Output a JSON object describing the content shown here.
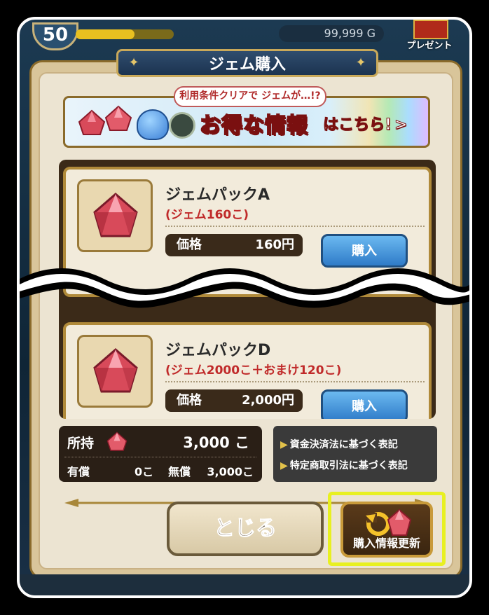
{
  "hud": {
    "level": "50",
    "gold": "99,999 G",
    "present_label": "プレゼント"
  },
  "dialog": {
    "title": "ジェム購入",
    "banner": {
      "tag": "利用条件クリアで ジェムが…!?",
      "main": "お得な情報",
      "sub": "はこちら!",
      "arrow": ">"
    },
    "products": [
      {
        "name": "ジェムパックA",
        "detail": "(ジェム160こ)",
        "price_label": "価格",
        "price": "160円",
        "buy_label": "購入"
      },
      {
        "name": "ジェムパックD",
        "detail": "(ジェム2000こ＋おまけ120こ)",
        "price_label": "価格",
        "price": "2,000円",
        "buy_label": "購入"
      }
    ],
    "holdings": {
      "label": "所持",
      "total": "3,000 こ",
      "paid_label": "有償",
      "paid_value": "0こ",
      "free_label": "無償",
      "free_value": "3,000こ"
    },
    "links": [
      "資金決済法に基づく表記",
      "特定商取引法に基づく表記"
    ],
    "close_label": "とじる",
    "refresh_label": "購入情報更新"
  },
  "colors": {
    "accent_highlight": "#e8f020",
    "price_text": "#c02a2a",
    "gold_border": "#b08a3a"
  }
}
